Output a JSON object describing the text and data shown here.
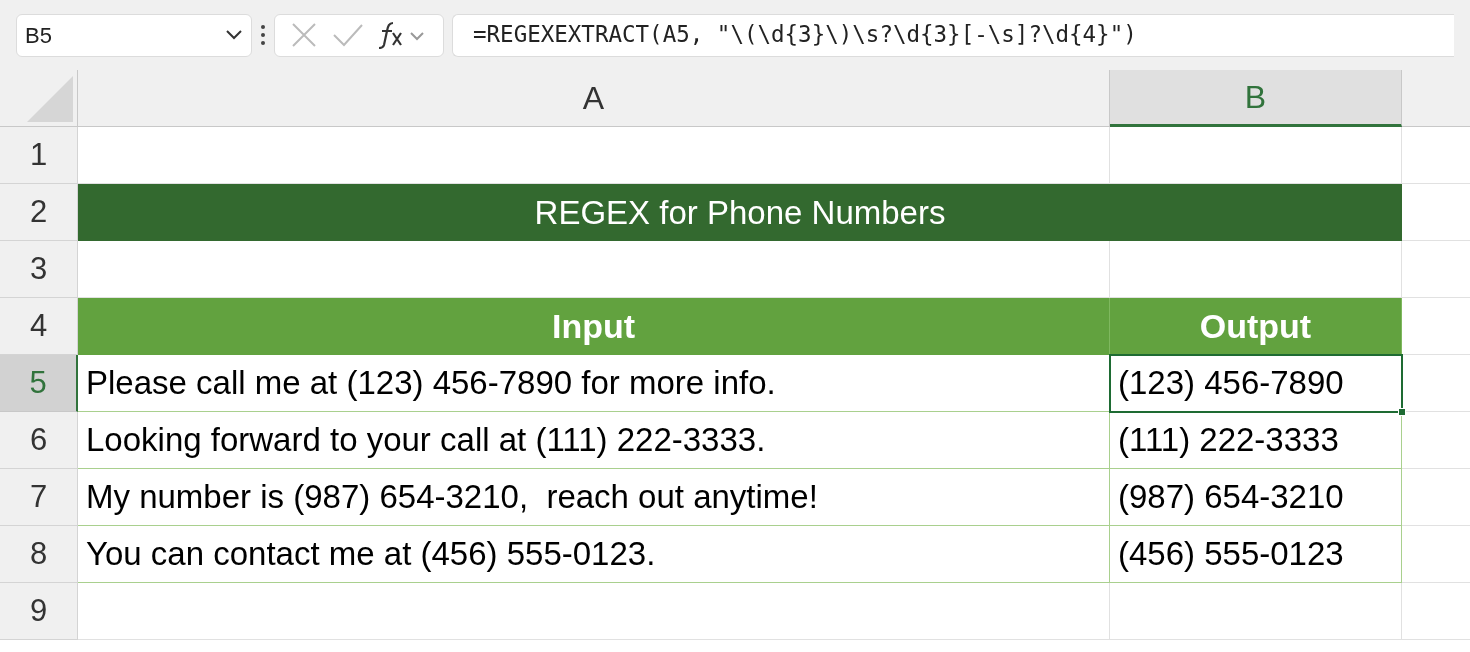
{
  "name_box": {
    "value": "B5"
  },
  "formula_bar": {
    "value": "=REGEXEXTRACT(A5, \"\\(\\d{3}\\)\\s?\\d{3}[-\\s]?\\d{4}\")"
  },
  "columns": [
    {
      "label": "A",
      "selected": false
    },
    {
      "label": "B",
      "selected": true
    }
  ],
  "rows": [
    {
      "number": "1",
      "selected": false,
      "kind": "empty"
    },
    {
      "number": "2",
      "selected": false,
      "kind": "title",
      "text": "REGEX for Phone Numbers"
    },
    {
      "number": "3",
      "selected": false,
      "kind": "empty"
    },
    {
      "number": "4",
      "selected": false,
      "kind": "header",
      "cells": [
        {
          "text": "Input",
          "selected": false
        },
        {
          "text": "Output",
          "selected": false
        }
      ]
    },
    {
      "number": "5",
      "selected": true,
      "kind": "data",
      "cells": [
        {
          "text": "Please call me at (123) 456-7890 for more info.",
          "selected": false
        },
        {
          "text": "(123) 456-7890",
          "selected": true
        }
      ]
    },
    {
      "number": "6",
      "selected": false,
      "kind": "data",
      "cells": [
        {
          "text": "Looking forward to your call at (111) 222-3333.",
          "selected": false
        },
        {
          "text": "(111) 222-3333",
          "selected": false
        }
      ]
    },
    {
      "number": "7",
      "selected": false,
      "kind": "data",
      "cells": [
        {
          "text": "My number is (987) 654-3210,  reach out anytime!",
          "selected": false
        },
        {
          "text": "(987) 654-3210",
          "selected": false
        }
      ]
    },
    {
      "number": "8",
      "selected": false,
      "kind": "data",
      "cells": [
        {
          "text": "You can contact me at (456) 555-0123.",
          "selected": false
        },
        {
          "text": "(456) 555-0123",
          "selected": false
        }
      ]
    },
    {
      "number": "9",
      "selected": false,
      "kind": "empty"
    }
  ]
}
